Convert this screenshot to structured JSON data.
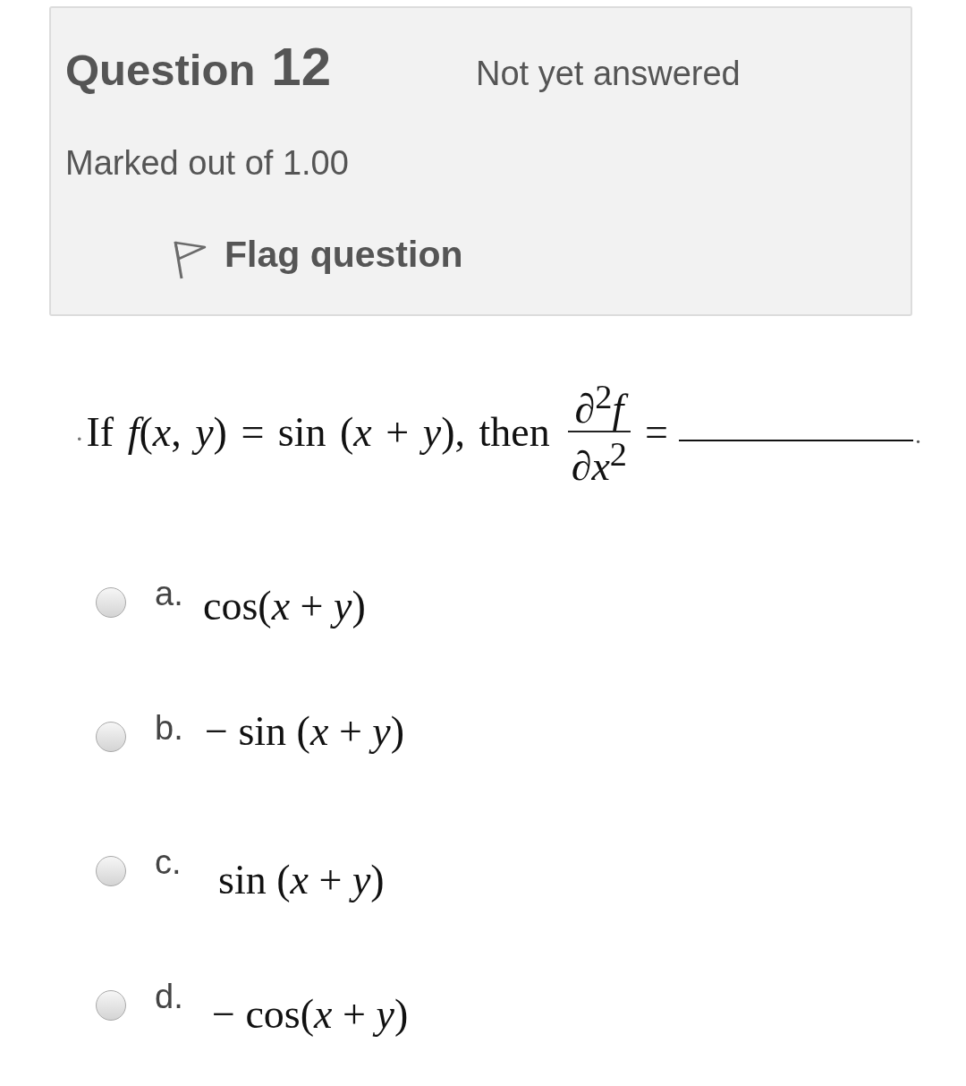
{
  "question_header": {
    "label": "Question",
    "number": "12",
    "status": "Not yet answered",
    "grade": "Marked out of 1.00",
    "flag": {
      "label": "Flag question",
      "flagged": false
    }
  },
  "question": {
    "lead_mark": ".",
    "stem": "If *f*(*x*, *y*) = sin (*x* + *y*), then",
    "fraction": {
      "numerator": "∂$^{2}$*f*",
      "denominator": "∂*x*$^{2}$"
    },
    "equals": "=",
    "end_mark": "."
  },
  "options": [
    {
      "letter": "a.",
      "answer": "cos(*x* + *y*)",
      "selected": false
    },
    {
      "letter": "b.",
      "answer": "− sin (*x* + *y*)",
      "selected": false
    },
    {
      "letter": "c.",
      "answer": "sin (*x* + *y*)",
      "selected": false
    },
    {
      "letter": "d.",
      "answer": "− cos(*x* + *y*)",
      "selected": false
    }
  ]
}
